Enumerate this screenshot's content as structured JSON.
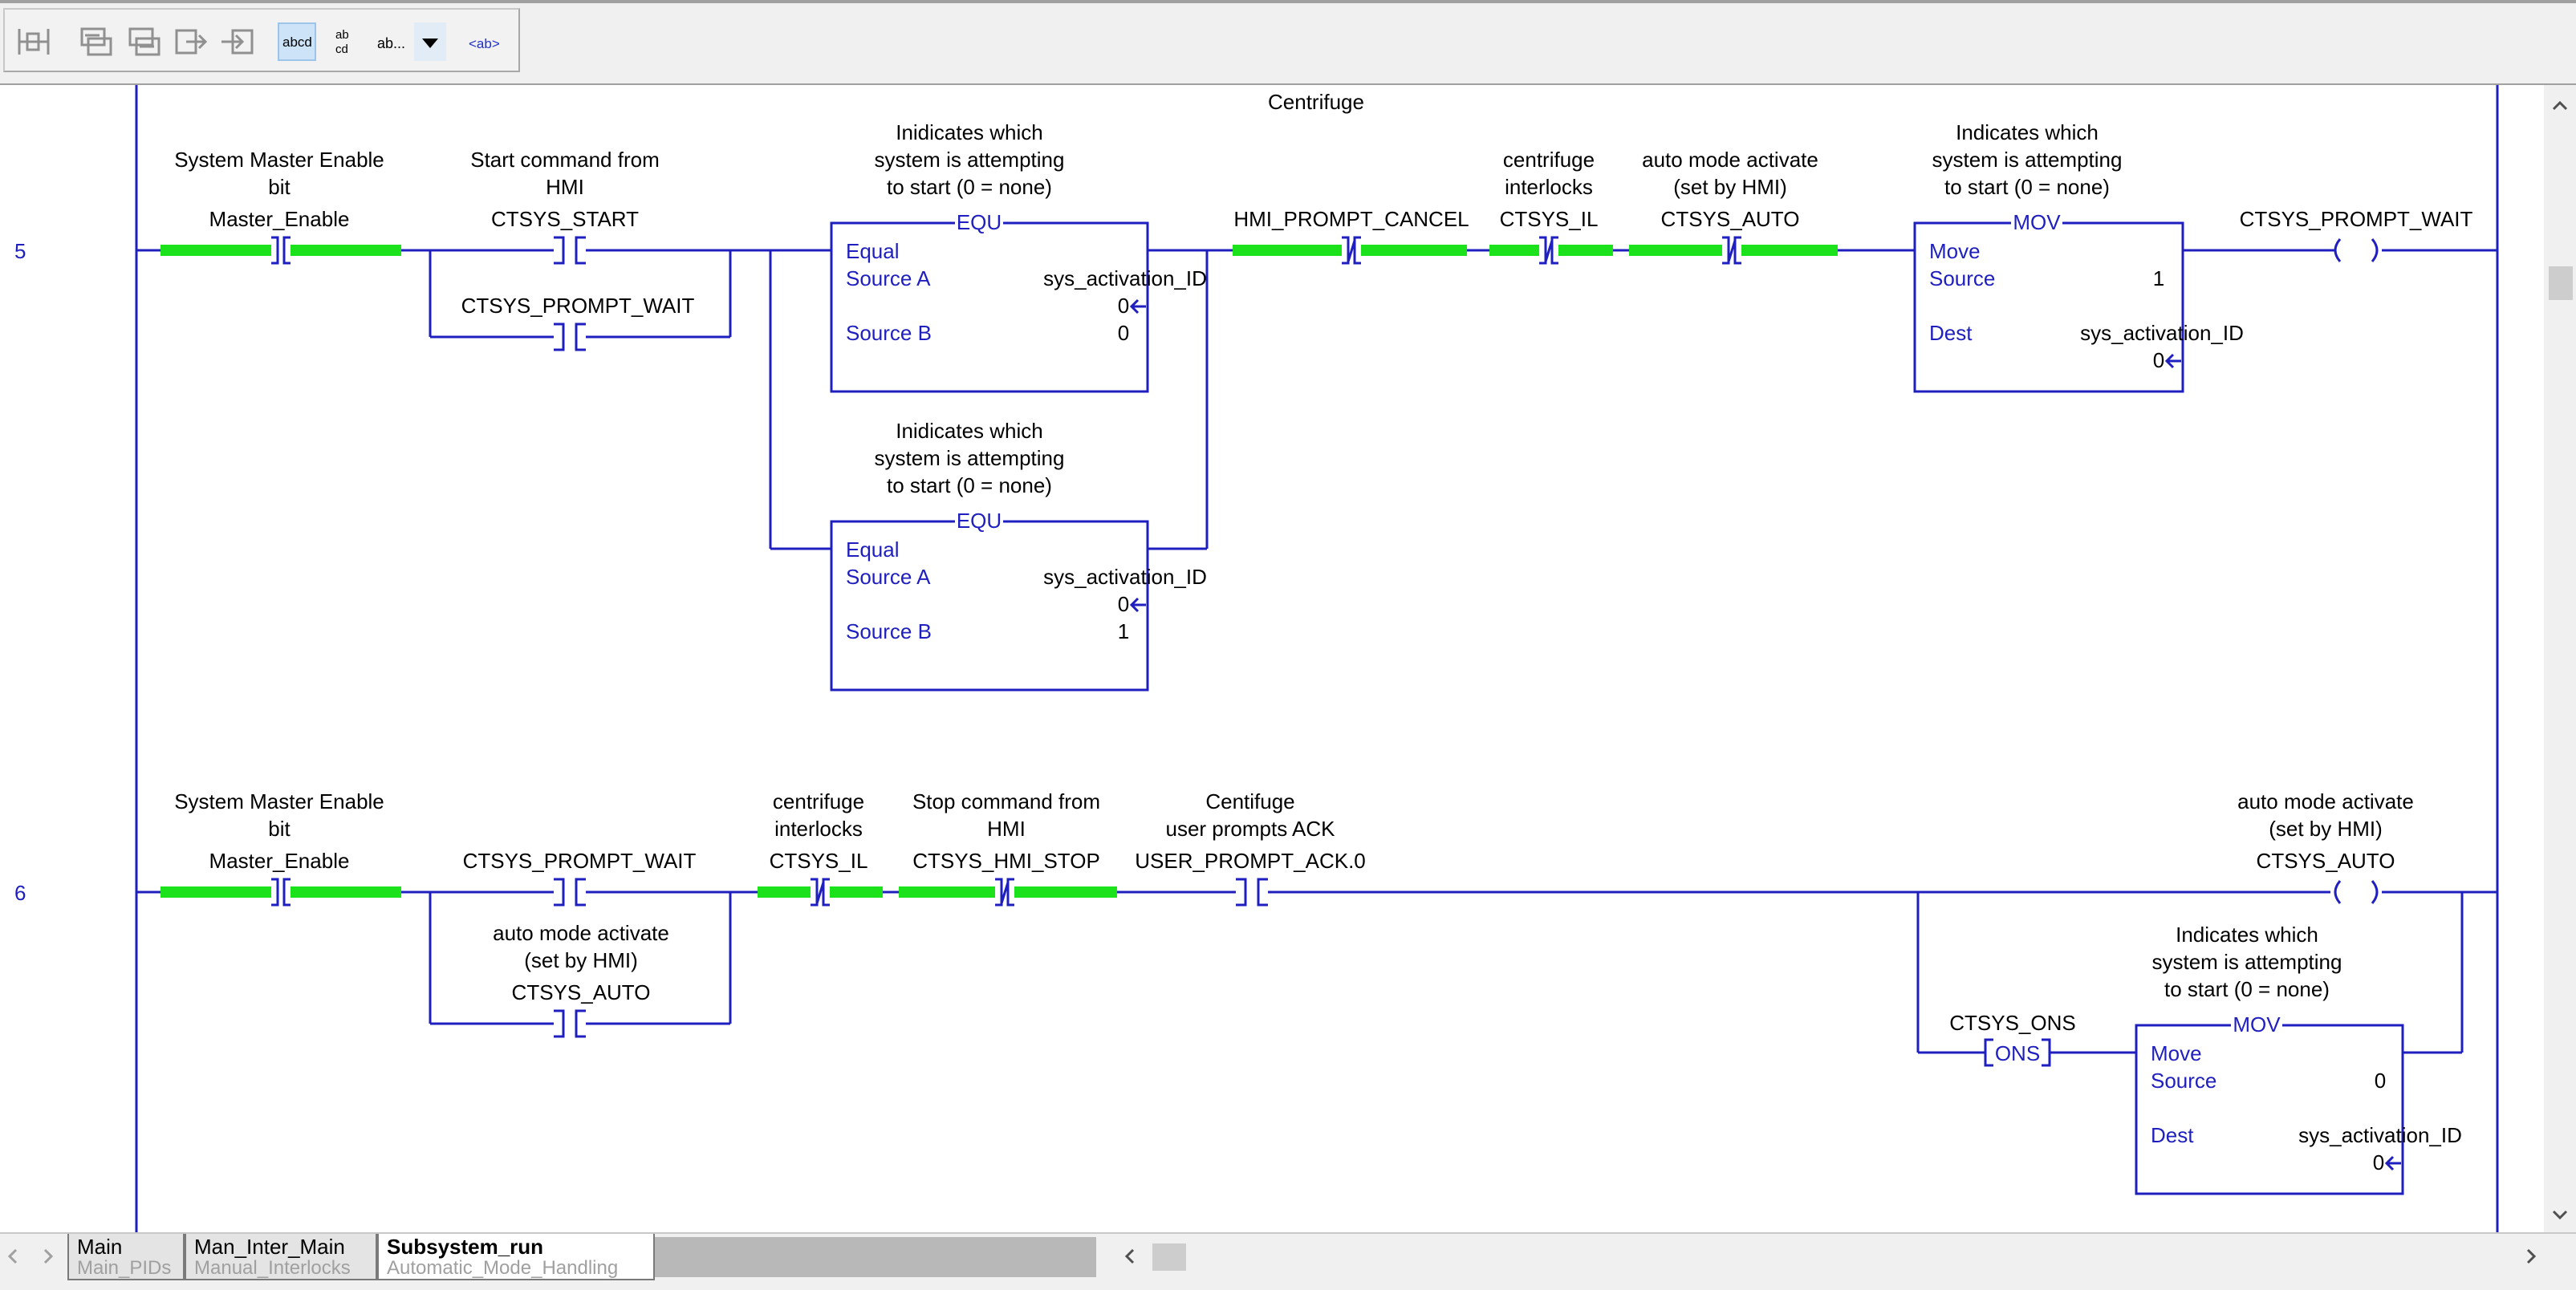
{
  "toolbar": {
    "icons": [
      "rung-icon",
      "branch-icon",
      "nested-branch-icon",
      "export-icon",
      "import-icon",
      "text-wrap-icon",
      "tag-display-icon",
      "tag-format-icon",
      "dropdown-icon",
      "tag-bracket-icon"
    ],
    "text_wrap_glyph": "abcd",
    "tag_display_glyph": "ab cd",
    "tag_format_glyph": "ab...",
    "tag_bracket_glyph": "<ab>"
  },
  "colors": {
    "wire": "#1f1fc0",
    "energized": "#1be21b",
    "label": "#000000"
  },
  "rung5": {
    "number": "5",
    "comment_title": "Centrifuge",
    "xic1": {
      "desc": [
        "System Master Enable",
        "bit"
      ],
      "tag": "Master_Enable"
    },
    "xic2": {
      "desc": [
        "Start command from",
        "HMI"
      ],
      "tag": "CTSYS_START"
    },
    "xic3": {
      "tag": "CTSYS_PROMPT_WAIT"
    },
    "equ1": {
      "desc": [
        "Inidicates which",
        "system is attempting",
        "to start (0 = none)"
      ],
      "name": "EQU",
      "title": "Equal",
      "srcA_label": "Source A",
      "srcA_tag": "sys_activation_ID",
      "srcA_val": "0",
      "srcB_label": "Source B",
      "srcB_val": "0"
    },
    "equ2": {
      "desc": [
        "Inidicates which",
        "system is attempting",
        "to start (0 = none)"
      ],
      "name": "EQU",
      "title": "Equal",
      "srcA_label": "Source A",
      "srcA_tag": "sys_activation_ID",
      "srcA_val": "0",
      "srcB_label": "Source B",
      "srcB_val": "1"
    },
    "xio1": {
      "tag": "HMI_PROMPT_CANCEL"
    },
    "xio2": {
      "desc": [
        "centrifuge",
        "interlocks"
      ],
      "tag": "CTSYS_IL"
    },
    "xio3": {
      "desc": [
        "auto mode activate",
        "(set by HMI)"
      ],
      "tag": "CTSYS_AUTO"
    },
    "mov": {
      "desc": [
        "Indicates which",
        "system is attempting",
        "to start (0 = none)"
      ],
      "name": "MOV",
      "title": "Move",
      "src_label": "Source",
      "src_val": "1",
      "dest_label": "Dest",
      "dest_tag": "sys_activation_ID",
      "dest_val": "0"
    },
    "ote": {
      "tag": "CTSYS_PROMPT_WAIT"
    }
  },
  "rung6": {
    "number": "6",
    "xic1": {
      "desc": [
        "System Master Enable",
        "bit"
      ],
      "tag": "Master_Enable"
    },
    "xic2": {
      "tag": "CTSYS_PROMPT_WAIT"
    },
    "xic3": {
      "desc": [
        "auto mode activate",
        "(set by HMI)"
      ],
      "tag": "CTSYS_AUTO"
    },
    "xio1": {
      "desc": [
        "centrifuge",
        "interlocks"
      ],
      "tag": "CTSYS_IL"
    },
    "xio2": {
      "desc": [
        "Stop command from",
        "HMI"
      ],
      "tag": "CTSYS_HMI_STOP"
    },
    "xic4": {
      "desc": [
        "Centifuge",
        "user prompts ACK"
      ],
      "tag": "USER_PROMPT_ACK.0"
    },
    "ote": {
      "desc": [
        "auto mode activate",
        "(set by HMI)"
      ],
      "tag": "CTSYS_AUTO"
    },
    "ons": {
      "tag": "CTSYS_ONS",
      "label": "ONS"
    },
    "mov": {
      "desc": [
        "Indicates which",
        "system is attempting",
        "to start (0 = none)"
      ],
      "name": "MOV",
      "title": "Move",
      "src_label": "Source",
      "src_val": "0",
      "dest_label": "Dest",
      "dest_tag": "sys_activation_ID",
      "dest_val": "0"
    }
  },
  "tabs": [
    {
      "label": "Main",
      "sub": "Main_PIDs",
      "active": false
    },
    {
      "label": "Man_Inter_Main",
      "sub": "Manual_Interlocks",
      "active": false
    },
    {
      "label": "Subsystem_run",
      "sub": "Automatic_Mode_Handling",
      "active": true
    }
  ]
}
